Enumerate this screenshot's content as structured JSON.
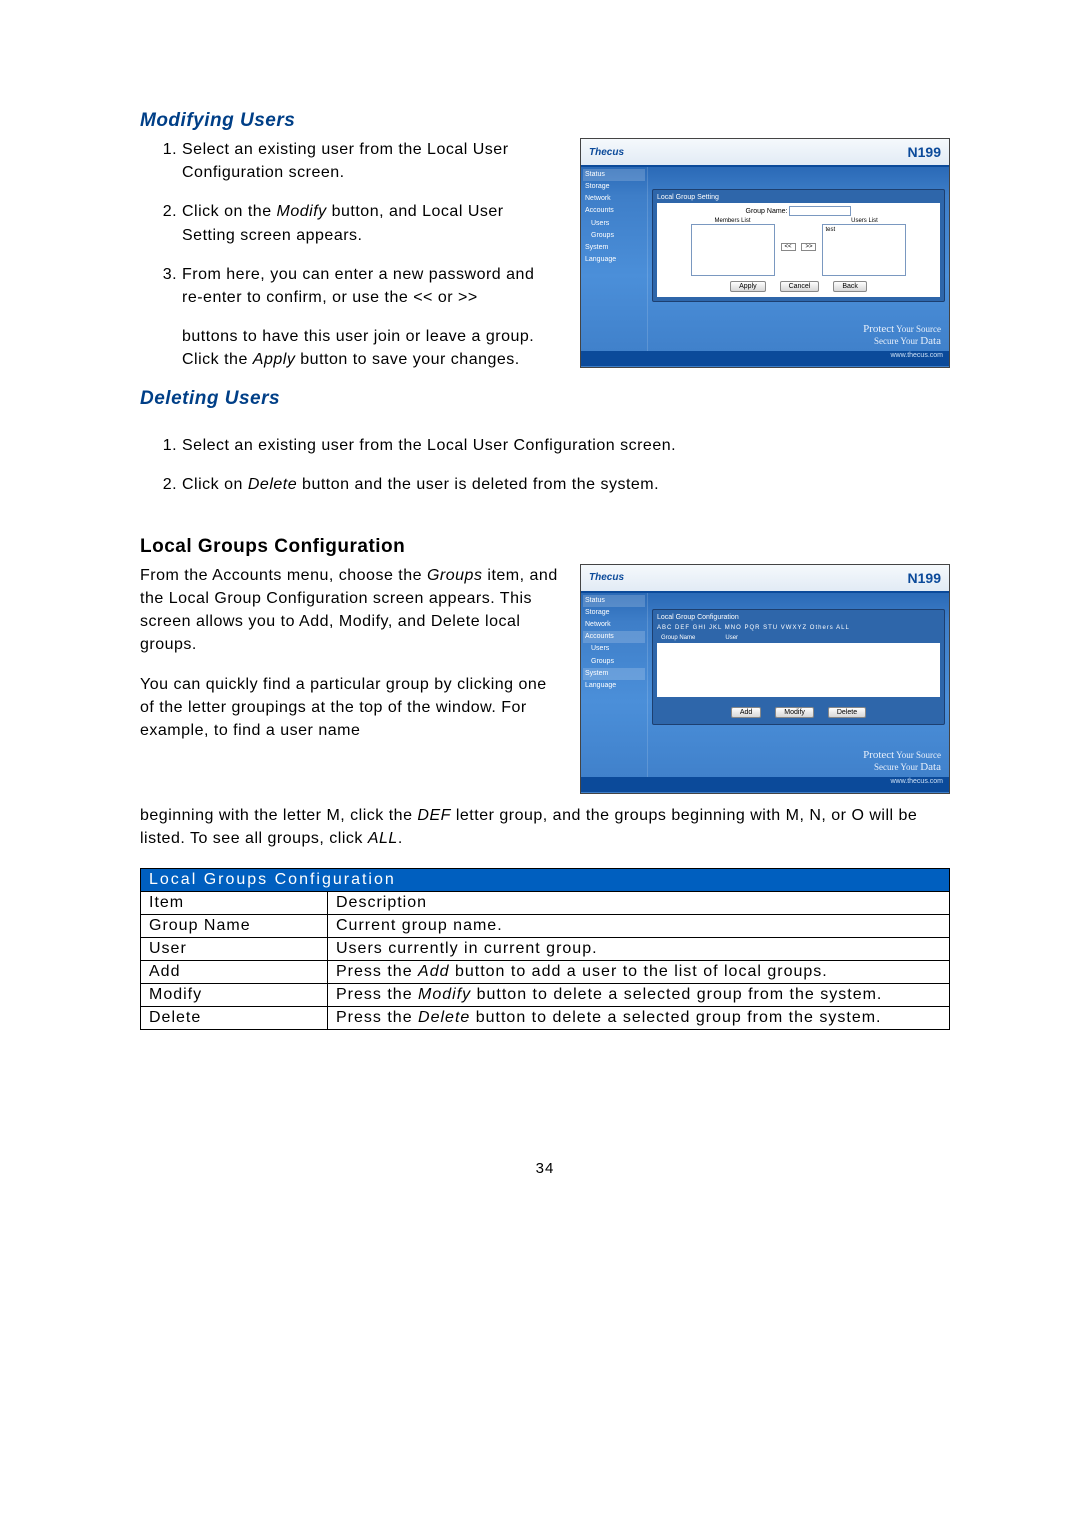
{
  "section1_title": "Modifying Users",
  "s1_step1": "Select an existing user from the Local User Configuration screen.",
  "s1_step2_a": "Click on the ",
  "s1_step2_b": "Modify",
  "s1_step2_c": " button, and Local User Setting screen appears.",
  "s1_step3": "From here, you can enter a new password and re-enter to confirm, or use the << or >>",
  "s1_follow_a": "buttons to have this user join or leave a group. Click the ",
  "s1_follow_b": "Apply",
  "s1_follow_c": " button to save your changes.",
  "section2_title": "Deleting Users",
  "s2_step1": "Select an existing user from the Local User Configuration screen.",
  "s2_step2_a": "Click on ",
  "s2_step2_b": "Delete",
  "s2_step2_c": " button and the user is deleted from the system.",
  "section3_title": "Local Groups Configuration",
  "s3_p1_a": "From the Accounts menu, choose the ",
  "s3_p1_b": "Groups",
  "s3_p1_c": " item, and the Local Group Configuration screen appears. This screen allows you to Add, Modify, and Delete local groups.",
  "s3_p2_a": "You can quickly find a particular group by clicking one of the letter groupings at the top of the window. For example, to find a user name",
  "s3_p3_a": "beginning with the letter M, click the ",
  "s3_p3_b": "DEF",
  "s3_p3_c": " letter group, and the groups beginning with M, N, or O will be listed. To see all groups, click ",
  "s3_p3_d": "ALL",
  "s3_p3_e": ".",
  "table_title": "Local Groups Configuration",
  "th_item": "Item",
  "th_desc": "Description",
  "row_group_name_i": "Group Name",
  "row_group_name_d": "Current group name.",
  "row_user_i": "User",
  "row_user_d": "Users currently in current group.",
  "row_add_i": "Add",
  "row_add_d_a": "Press the ",
  "row_add_d_b": "Add",
  "row_add_d_c": " button to add a user to the list of local groups.",
  "row_mod_i": "Modify",
  "row_mod_d_a": "Press the ",
  "row_mod_d_b": "Modify",
  "row_mod_d_c": " button to delete a selected group from the system.",
  "row_del_i": "Delete",
  "row_del_d_a": "Press the ",
  "row_del_d_b": "Delete",
  "row_del_d_c": " button to delete a selected group from the system.",
  "thumb_logo": "Thecus",
  "thumb_model": "N199",
  "footer_protect": "Protect",
  "footer_sub1": "Your Source",
  "footer_sub2": "Secure Your",
  "footer_data": "Data",
  "thumb_url": "www.thecus.com",
  "side_status": "Status",
  "side_storage": "Storage",
  "side_network": "Network",
  "side_accounts": "Accounts",
  "side_users": "Users",
  "side_groups": "Groups",
  "side_system": "System",
  "side_language": "Language",
  "panel1_title": "Local Group Setting",
  "panel1_groupname_lbl": "Group Name:",
  "panel1_members_lbl": "Members List",
  "panel1_users_lbl": "Users List",
  "panel1_user": "test",
  "btn_apply": "Apply",
  "btn_cancel": "Cancel",
  "btn_back": "Back",
  "panel2_title": "Local Group Configuration",
  "panel2_letters": "ABC  DEF  GHI  JKL  MNO  PQR  STU  VWXYZ  Others  ALL",
  "panel2_col_group": "Group Name",
  "panel2_col_user": "User",
  "btn_add": "Add",
  "btn_modify": "Modify",
  "btn_delete": "Delete",
  "page_number": "34"
}
